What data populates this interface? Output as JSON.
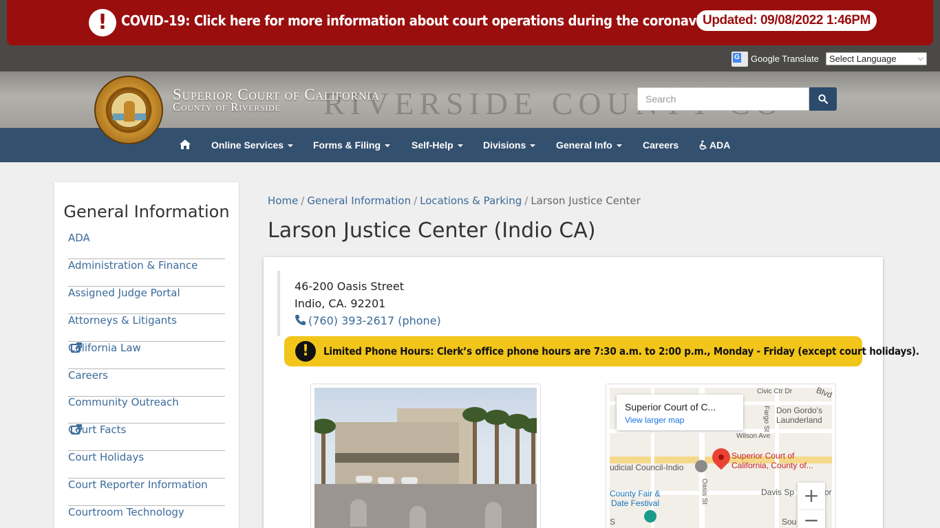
{
  "alert": {
    "icon": "exclamation-icon",
    "text": "COVID-19: Click here for more information about court operations during the coronavirus pandemic",
    "updated": "Updated: 09/08/2022 1:46PM",
    "color": "#9a0e0e"
  },
  "translate": {
    "label": "Google Translate",
    "select_value": "Select Language"
  },
  "header": {
    "title": "Superior Court of California",
    "subtitle": "County of Riverside",
    "banner_text": "RIVERSIDE COUNTY CO",
    "search_placeholder": "Search"
  },
  "nav": {
    "color": "#34506f",
    "items": [
      {
        "label": "Online Services",
        "dropdown": true
      },
      {
        "label": "Forms & Filing",
        "dropdown": true
      },
      {
        "label": "Self-Help",
        "dropdown": true
      },
      {
        "label": "Divisions",
        "dropdown": true
      },
      {
        "label": "General Info",
        "dropdown": true
      },
      {
        "label": "Careers",
        "dropdown": false
      },
      {
        "label": "ADA",
        "dropdown": false
      }
    ]
  },
  "sidebar": {
    "title": "General Information",
    "items": [
      {
        "label": "ADA",
        "external": false
      },
      {
        "label": "Administration & Finance",
        "external": false
      },
      {
        "label": "Assigned Judge Portal",
        "external": false
      },
      {
        "label": "Attorneys & Litigants",
        "external": false
      },
      {
        "label": "California Law",
        "external": true
      },
      {
        "label": "Careers",
        "external": false
      },
      {
        "label": "Community Outreach",
        "external": false
      },
      {
        "label": "Court Facts",
        "external": true
      },
      {
        "label": "Court Holidays",
        "external": false
      },
      {
        "label": "Court Reporter Information",
        "external": false
      },
      {
        "label": "Courtroom Technology",
        "external": false
      }
    ]
  },
  "breadcrumb": {
    "items": [
      "Home",
      "General Information",
      "Locations & Parking"
    ],
    "current": "Larson Justice Center"
  },
  "page": {
    "title": "Larson Justice Center (Indio CA)"
  },
  "location": {
    "street": "46-200 Oasis Street",
    "city": "Indio, CA. 92201",
    "phone": "(760) 393-2617 (phone)"
  },
  "notice": {
    "text": "Limited Phone Hours: Clerk’s office phone hours are 7:30 a.m. to 2:00 p.m., Monday - Friday (except court holidays).",
    "color": "#f2c51a"
  },
  "map": {
    "card_title": "Superior Court of C...",
    "card_link": "View larger map",
    "pin_label_1": "Superior Court of",
    "pin_label_2": "California, County of...",
    "labels": {
      "civic": "Civic Ctr Dr",
      "blvd": "Blvd",
      "dongordo1": "Don Gordo's",
      "dongordo2": "Launderland",
      "wilson": "Wilson Ave",
      "fargo": "Fargo St",
      "judicial": "udicial Council-Indio",
      "fair1": "County Fair &",
      "fair2": "Date Festival",
      "oasis": "Oasis St",
      "davis": "Davis Sp",
      "davis2": "or",
      "sou": "Sou",
      "s": "S"
    },
    "zoom_in": "+",
    "zoom_out": "−"
  }
}
